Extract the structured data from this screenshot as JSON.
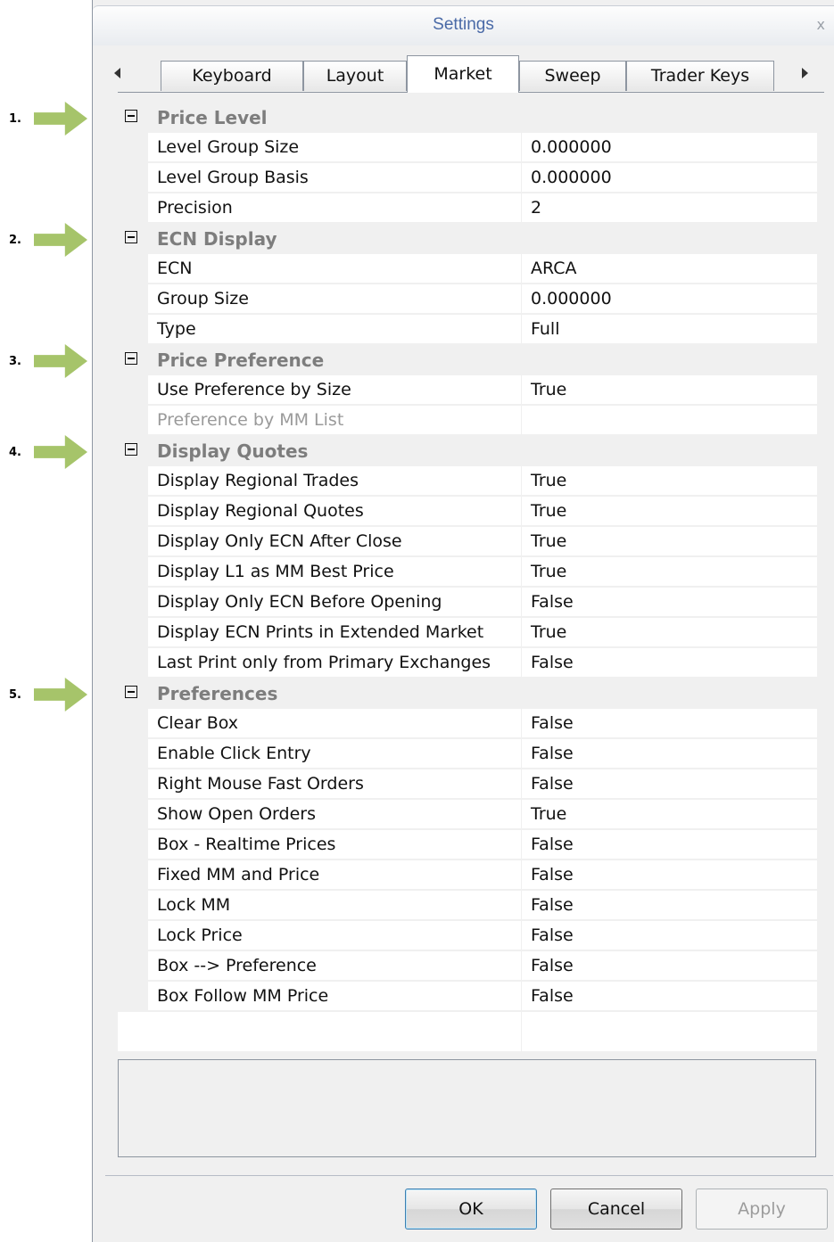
{
  "callouts": [
    "1.",
    "2.",
    "3.",
    "4.",
    "5."
  ],
  "window": {
    "title": "Settings",
    "close_glyph": "x"
  },
  "tabs": [
    "Keyboard",
    "Layout",
    "Market",
    "Sweep",
    "Trader Keys"
  ],
  "active_tab": "Market",
  "categories": [
    {
      "label": "Price Level",
      "rows": [
        {
          "name": "Level Group Size",
          "value": "0.000000"
        },
        {
          "name": "Level Group Basis",
          "value": "0.000000"
        },
        {
          "name": "Precision",
          "value": "2"
        }
      ]
    },
    {
      "label": "ECN Display",
      "rows": [
        {
          "name": "ECN",
          "value": "ARCA"
        },
        {
          "name": "Group Size",
          "value": "0.000000"
        },
        {
          "name": "Type",
          "value": "Full"
        }
      ]
    },
    {
      "label": "Price Preference",
      "rows": [
        {
          "name": "Use Preference by Size",
          "value": "True"
        },
        {
          "name": "Preference by MM List",
          "value": ""
        }
      ]
    },
    {
      "label": "Display Quotes",
      "rows": [
        {
          "name": "Display Regional Trades",
          "value": "True"
        },
        {
          "name": "Display Regional Quotes",
          "value": "True"
        },
        {
          "name": "Display Only ECN After Close",
          "value": "True"
        },
        {
          "name": "Display L1 as MM Best Price",
          "value": "True"
        },
        {
          "name": "Display Only ECN Before Opening",
          "value": "False"
        },
        {
          "name": "Display ECN Prints in Extended Market",
          "value": "True"
        },
        {
          "name": "Last Print only from Primary Exchanges",
          "value": "False"
        }
      ]
    },
    {
      "label": "Preferences",
      "rows": [
        {
          "name": "Clear Box",
          "value": "False"
        },
        {
          "name": "Enable Click Entry",
          "value": "False"
        },
        {
          "name": "Right Mouse Fast Orders",
          "value": "False"
        },
        {
          "name": "Show Open Orders",
          "value": "True"
        },
        {
          "name": "Box - Realtime Prices",
          "value": "False"
        },
        {
          "name": "Fixed MM and Price",
          "value": "False"
        },
        {
          "name": "Lock MM",
          "value": "False"
        },
        {
          "name": "Lock Price",
          "value": "False"
        },
        {
          "name": "Box --> Preference",
          "value": "False"
        },
        {
          "name": "Box Follow MM Price",
          "value": "False"
        }
      ]
    }
  ],
  "buttons": {
    "ok": "OK",
    "cancel": "Cancel",
    "apply": "Apply"
  },
  "colors": {
    "title_text": "#4a6aa7",
    "callout_arrow": "#a6c46a",
    "category_text": "#7d7d7d"
  }
}
